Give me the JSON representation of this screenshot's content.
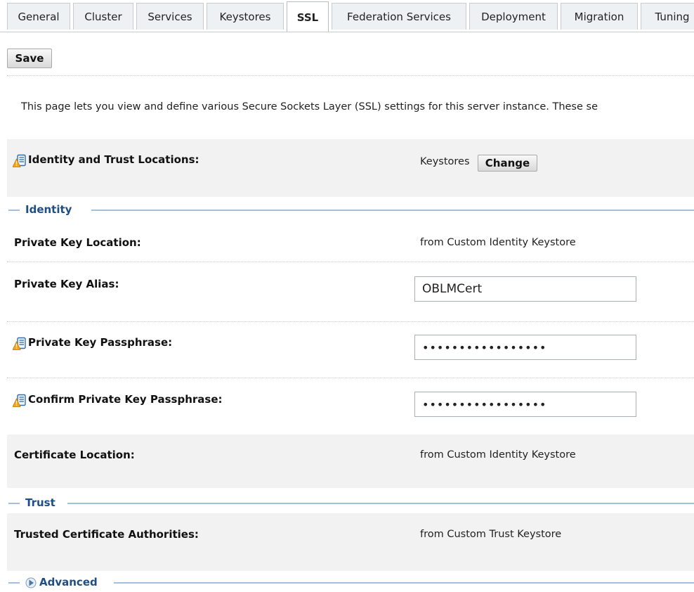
{
  "tabs": [
    {
      "label": "General"
    },
    {
      "label": "Cluster"
    },
    {
      "label": "Services"
    },
    {
      "label": "Keystores"
    },
    {
      "label": "SSL"
    },
    {
      "label": "Federation Services"
    },
    {
      "label": "Deployment"
    },
    {
      "label": "Migration"
    },
    {
      "label": "Tuning"
    }
  ],
  "active_tab": "SSL",
  "toolbar": {
    "save_label": "Save"
  },
  "description": "This page lets you view and define various Secure Sockets Layer (SSL) settings for this server instance. These se",
  "identity_trust": {
    "label": "Identity and Trust Locations:",
    "value": "Keystores",
    "change_label": "Change"
  },
  "sections": {
    "identity": "Identity",
    "trust": "Trust",
    "advanced": "Advanced"
  },
  "identity": {
    "private_key_location": {
      "label": "Private Key Location:",
      "value": "from Custom Identity Keystore"
    },
    "private_key_alias": {
      "label": "Private Key Alias:",
      "value": "OBLMCert"
    },
    "private_key_passphrase": {
      "label": "Private Key Passphrase:",
      "value": "•••••••••••••••••"
    },
    "confirm_private_key_passphrase": {
      "label": "Confirm Private Key Passphrase:",
      "value": "•••••••••••••••••"
    },
    "certificate_location": {
      "label": "Certificate Location:",
      "value": "from Custom Identity Keystore"
    }
  },
  "trust": {
    "trusted_certificate_authorities": {
      "label": "Trusted Certificate Authorities:",
      "value": "from Custom Trust Keystore"
    }
  },
  "icons": {
    "config_change": "config-change-warning-icon",
    "advanced_expand": "expand-triangle-icon"
  },
  "colors": {
    "section_title": "#1f4e85",
    "section_rule": "#a4bfd9",
    "row_shade": "#f2f2f2"
  }
}
